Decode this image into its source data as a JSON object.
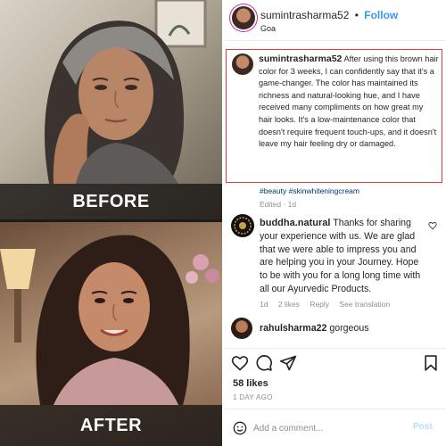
{
  "photos": {
    "before_label": "BEFORE",
    "after_label": "AFTER"
  },
  "post": {
    "author": "sumintrasharma52",
    "separator": "•",
    "follow_label": "Follow",
    "location": "Goa",
    "caption_username": "sumintrasharma52",
    "caption_text": "After using this brown hair color for 3 weeks, I can confidently say that it's a game-changer. The color has maintained its richness and natural-looking hue, and I have received many compliments on how great my hair looks. It's a low-maintenance color that doesn't require frequent touch-ups, and it doesn't leave my hair feeling dry or damaged.",
    "hashtags": "#beauty #skinwhiteningcream",
    "edited_meta": "Edited · 1d"
  },
  "comments": [
    {
      "username": "buddha.natural",
      "text": "Thanks for sharing your experience with us. We are glad that we were able to impress you and are helping you in your Journey. Hope to be with you for a long long time with all our Ayurvedic Products.",
      "age": "1d",
      "likes": "2 likes",
      "reply_label": "Reply",
      "translation_label": "See translation"
    },
    {
      "username": "rahulsharma22",
      "text": "gorgeous"
    }
  ],
  "footer": {
    "likes": "58 likes",
    "time_ago": "1 DAY AGO",
    "comment_placeholder": "Add a comment...",
    "post_label": "Post"
  },
  "icons": {
    "like": "heart-icon",
    "comment": "comment-icon",
    "share": "send-icon",
    "save": "bookmark-icon",
    "emoji": "smiley-icon"
  },
  "colors": {
    "follow": "#3897f0",
    "highlight_border": "#e03a3a",
    "post_button": "#b2dffc",
    "hashtag": "#00376b"
  }
}
